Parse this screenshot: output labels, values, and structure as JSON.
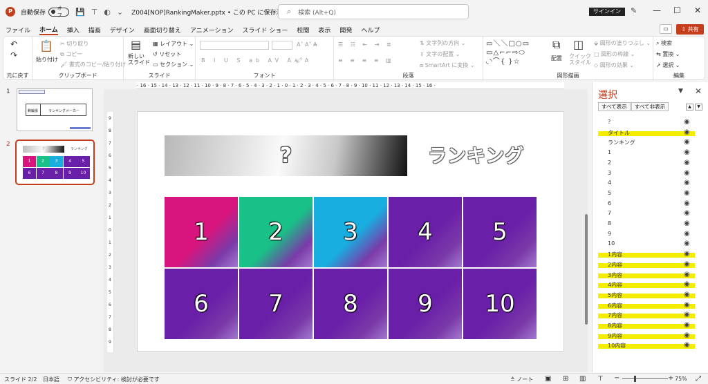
{
  "titlebar": {
    "logo": "P",
    "autosave_label": "自動保存",
    "autosave_state": "オフ",
    "file_title": "Z004[NOP]RankingMaker.pptx • この PC に保存済み ∨",
    "search_placeholder": "検索 (Alt+Q)",
    "signin_label": "サインイン",
    "minimize": "—",
    "restore": "☐",
    "close": "✕"
  },
  "menu": {
    "items": [
      "ファイル",
      "ホーム",
      "挿入",
      "描画",
      "デザイン",
      "画面切り替え",
      "アニメーション",
      "スライド ショー",
      "校閲",
      "表示",
      "開発",
      "ヘルプ"
    ],
    "active_index": 1,
    "share_label": "共有"
  },
  "ribbon": {
    "undo_group": "元に戻す",
    "clipboard": {
      "label": "クリップボード",
      "paste": "貼り付け",
      "cut": "切り取り",
      "copy": "コピー",
      "format_painter": "書式のコピー/貼り付け"
    },
    "slides": {
      "label": "スライド",
      "new_slide": "新しい\nスライド",
      "layout": "レイアウト",
      "reset": "リセット",
      "section": "セクション"
    },
    "font": {
      "label": "フォント"
    },
    "paragraph": {
      "label": "段落",
      "text_direction": "文字列の方向",
      "align_text": "文字の配置",
      "smartart": "SmartArt に変換"
    },
    "drawing": {
      "label": "図形描画",
      "arrange": "配置",
      "quick_styles": "クイック\nスタイル",
      "shape_fill": "図形の塗りつぶし",
      "shape_outline": "図形の枠線",
      "shape_effects": "図形の効果"
    },
    "editing": {
      "label": "編集",
      "find": "検索",
      "replace": "置換",
      "select": "選択"
    }
  },
  "ruler": {
    "horizontal": "· 16 · 15 · 14 · 13 · 12 · 11 · 10 · 9 · 8 · 7 · 6 · 5 · 4 · 3 · 2 · 1 · 0 · 1 · 2 · 3 · 4 · 5 · 6 · 7 · 8 · 9 · 10 · 11 · 12 · 13 · 14 · 15 · 16 ·",
    "vertical": [
      "9",
      "8",
      "7",
      "6",
      "5",
      "4",
      "3",
      "2",
      "1",
      "0",
      "1",
      "2",
      "3",
      "4",
      "5",
      "6",
      "7",
      "8",
      "9"
    ]
  },
  "thumbnails": [
    {
      "number": "1",
      "left_text": "剰編張",
      "title_text": "ランキングメーカー"
    },
    {
      "number": "2",
      "question": "?",
      "rank_text": "ランキング",
      "cells": [
        "1",
        "2",
        "3",
        "4",
        "5",
        "6",
        "7",
        "8",
        "9",
        "10"
      ]
    }
  ],
  "slide": {
    "question": "?",
    "ranking_title": "ランキング",
    "cells": [
      "1",
      "2",
      "3",
      "4",
      "5",
      "6",
      "7",
      "8",
      "9",
      "10"
    ],
    "cell_colors": [
      "#d8157e",
      "#19c088",
      "#18aee0",
      "#6a1fa8",
      "#6a1fa8",
      "#6a1fa8",
      "#6a1fa8",
      "#6a1fa8",
      "#6a1fa8",
      "#6a1fa8"
    ]
  },
  "selection_pane": {
    "title": "選択",
    "show_all": "すべて表示",
    "hide_all": "すべて非表示",
    "items": [
      {
        "label": "?",
        "highlighted": false
      },
      {
        "label": "タイトル",
        "highlighted": true
      },
      {
        "label": "ランキング",
        "highlighted": false
      },
      {
        "label": "1",
        "highlighted": false
      },
      {
        "label": "2",
        "highlighted": false
      },
      {
        "label": "3",
        "highlighted": false
      },
      {
        "label": "4",
        "highlighted": false
      },
      {
        "label": "5",
        "highlighted": false
      },
      {
        "label": "6",
        "highlighted": false
      },
      {
        "label": "7",
        "highlighted": false
      },
      {
        "label": "8",
        "highlighted": false
      },
      {
        "label": "9",
        "highlighted": false
      },
      {
        "label": "10",
        "highlighted": false
      },
      {
        "label": "1内容",
        "highlighted": true
      },
      {
        "label": "2内容",
        "highlighted": true
      },
      {
        "label": "3内容",
        "highlighted": true
      },
      {
        "label": "4内容",
        "highlighted": true
      },
      {
        "label": "5内容",
        "highlighted": true
      },
      {
        "label": "6内容",
        "highlighted": true
      },
      {
        "label": "7内容",
        "highlighted": true
      },
      {
        "label": "8内容",
        "highlighted": true
      },
      {
        "label": "9内容",
        "highlighted": true
      },
      {
        "label": "10内容",
        "highlighted": true
      }
    ],
    "highlight_color": "#f5ed00"
  },
  "status": {
    "slide_count": "スライド 2/2",
    "language": "日本語",
    "accessibility": "アクセシビリティ: 検討が必要です",
    "notes": "ノート",
    "zoom": "75%"
  },
  "colors": {
    "accent": "#c43e1c"
  }
}
